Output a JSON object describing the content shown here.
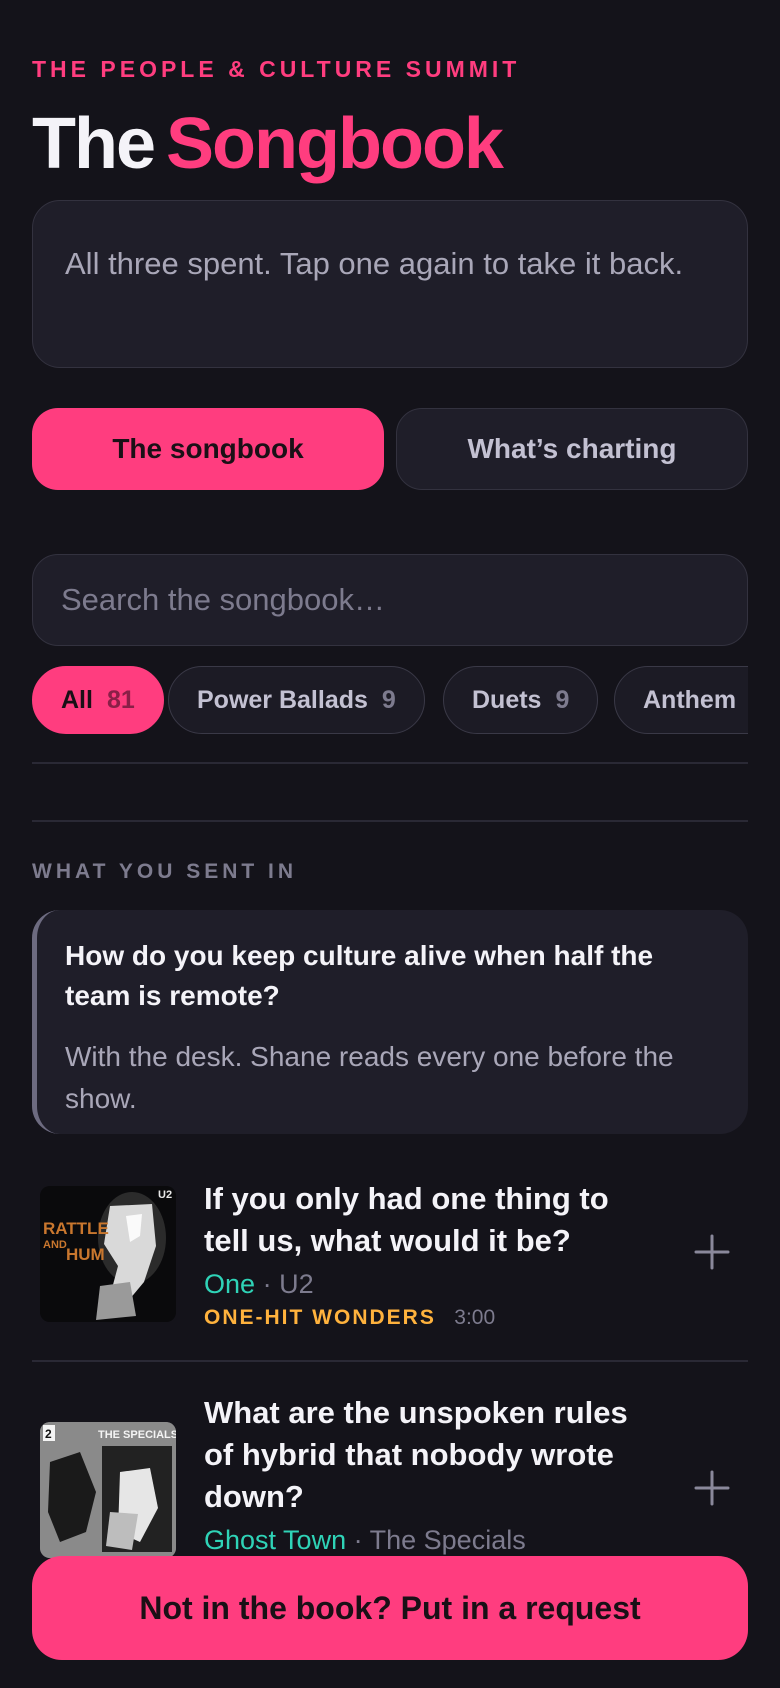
{
  "header": {
    "eyebrow": "THE PEOPLE & CULTURE SUMMIT",
    "title_part1": "The",
    "title_part2": "Songbook"
  },
  "status_message": "All three spent. Tap one again to take it back.",
  "tabs": [
    {
      "label": "The songbook",
      "active": true
    },
    {
      "label": "What’s charting",
      "active": false
    }
  ],
  "search": {
    "placeholder": "Search the songbook…"
  },
  "filters": [
    {
      "label": "All",
      "count": "81",
      "active": true
    },
    {
      "label": "Power Ballads",
      "count": "9",
      "active": false
    },
    {
      "label": "Duets",
      "count": "9",
      "active": false
    },
    {
      "label": "Anthem",
      "count": "",
      "active": false
    }
  ],
  "sent_in": {
    "section_label": "WHAT YOU SENT IN",
    "question": "How do you keep culture alive when half the team is remote?",
    "note": "With the desk. Shane reads every one before the show."
  },
  "songs": [
    {
      "question": "If you only had one thing to tell us, what would it be?",
      "song": "One",
      "separator": "·",
      "artist": "U2",
      "tag": "ONE-HIT WONDERS",
      "duration": "3:00",
      "art_icon": "album-art-rattle-and-hum",
      "art_text_1": "RATTLE",
      "art_text_2": "AND",
      "art_text_3": "HUM"
    },
    {
      "question": "What are the unspoken rules of hybrid that nobody wrote down?",
      "song": "Ghost Town",
      "separator": "·",
      "artist": "The Specials",
      "art_icon": "album-art-the-specials",
      "art_text_1": "THE SPECIALS"
    }
  ],
  "cta_label": "Not in the book? Put in a request",
  "colors": {
    "background": "#14131a",
    "accent": "#ff3d7f",
    "song_title": "#2fd3b7",
    "tag": "#ffb23d"
  }
}
